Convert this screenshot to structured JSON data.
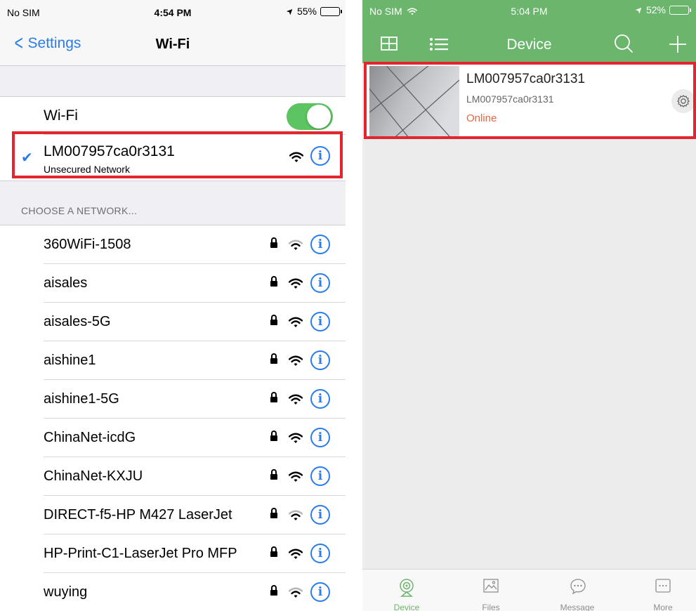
{
  "left": {
    "status": {
      "carrier": "No SIM",
      "time": "4:54 PM",
      "battery": "55%",
      "battery_level": 0.55
    },
    "nav": {
      "back_label": "Settings",
      "title": "Wi-Fi"
    },
    "wifi_label": "Wi-Fi",
    "wifi_enabled": true,
    "connected": {
      "name": "LM007957ca0r3131",
      "subtitle": "Unsecured Network"
    },
    "section_header": "CHOOSE A NETWORK...",
    "networks": [
      {
        "name": "360WiFi-1508",
        "locked": true,
        "signal": "weak"
      },
      {
        "name": "aisales",
        "locked": true,
        "signal": "strong"
      },
      {
        "name": "aisales-5G",
        "locked": true,
        "signal": "strong"
      },
      {
        "name": "aishine1",
        "locked": true,
        "signal": "strong"
      },
      {
        "name": "aishine1-5G",
        "locked": true,
        "signal": "strong"
      },
      {
        "name": "ChinaNet-icdG",
        "locked": true,
        "signal": "strong"
      },
      {
        "name": "ChinaNet-KXJU",
        "locked": true,
        "signal": "strong"
      },
      {
        "name": "DIRECT-f5-HP M427 LaserJet",
        "locked": true,
        "signal": "weak"
      },
      {
        "name": "HP-Print-C1-LaserJet Pro MFP",
        "locked": true,
        "signal": "strong"
      },
      {
        "name": "wuying",
        "locked": true,
        "signal": "weak"
      }
    ]
  },
  "right": {
    "status": {
      "carrier": "No SIM",
      "time": "5:04 PM",
      "battery": "52%",
      "battery_level": 0.52
    },
    "nav": {
      "title": "Device"
    },
    "device": {
      "title": "LM007957ca0r3131",
      "id": "LM007957ca0r3131",
      "status": "Online"
    },
    "tabs": [
      {
        "label": "Device",
        "icon": "camera-icon",
        "active": true
      },
      {
        "label": "Files",
        "icon": "image-icon",
        "active": false
      },
      {
        "label": "Message",
        "icon": "message-icon",
        "active": false
      },
      {
        "label": "More",
        "icon": "more-icon",
        "active": false
      }
    ]
  },
  "colors": {
    "ios_blue": "#2a7ce8",
    "toggle_green": "#5cc460",
    "app_green": "#6bb56d",
    "highlight_red": "#e3262e",
    "online_orange": "#e8663f"
  }
}
